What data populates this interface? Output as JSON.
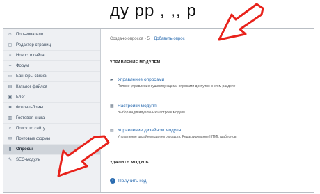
{
  "banner": {
    "text": "ду рр , ,, р"
  },
  "sidebar": {
    "items": [
      {
        "label": "Пользователи",
        "icon": "user-icon"
      },
      {
        "label": "Редактор страниц",
        "icon": "page-icon"
      },
      {
        "label": "Новости сайта",
        "icon": "news-icon"
      },
      {
        "label": "Форум",
        "icon": "forum-icon"
      },
      {
        "label": "Баннеры связей",
        "icon": "banner-icon"
      },
      {
        "label": "Каталог файлов",
        "icon": "folder-icon"
      },
      {
        "label": "Блог",
        "icon": "blog-icon"
      },
      {
        "label": "Фотоальбомы",
        "icon": "photo-icon"
      },
      {
        "label": "Гостевая книга",
        "icon": "book-icon"
      },
      {
        "label": "Поиск по сайту",
        "icon": "search-icon"
      },
      {
        "label": "Почтовые формы",
        "icon": "mail-icon"
      },
      {
        "label": "Опросы",
        "icon": "poll-icon"
      },
      {
        "label": "SEO-модуль",
        "icon": "seo-icon"
      }
    ],
    "active_index": 11
  },
  "topbar": {
    "count_text": "Создано опросов - 5",
    "add_link": "| Добавить опрос"
  },
  "manage": {
    "title": "УПРАВЛЕНИЕ МОДУЛЕМ",
    "entries": [
      {
        "label": "Управление опросами",
        "desc": "Полное управление существующими опросами доступно в этом разделе",
        "icon": "list-icon"
      },
      {
        "label": "Настройки модуля",
        "desc": "Выбор индивидуальных настроек модуля",
        "icon": "settings-icon"
      },
      {
        "label": "Управление дизайном модуля",
        "desc": "Управление дизайном данного модуля. Редактирование HTML шаблонов",
        "icon": "design-icon"
      }
    ]
  },
  "remove": {
    "title": "УДАЛИТЬ МОДУЛЬ",
    "link": "Получить код"
  },
  "colors": {
    "arrow_red": "#e8221b",
    "link_blue": "#2b6cb0",
    "sidebar_bg": "#eef0f3"
  }
}
